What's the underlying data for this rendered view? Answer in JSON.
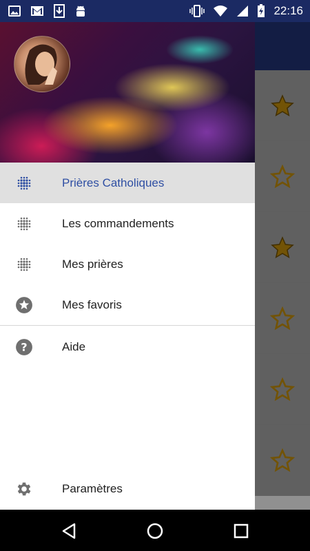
{
  "status_bar": {
    "time": "22:16",
    "icons_left": [
      "image-icon",
      "gmail-icon",
      "download-icon",
      "android-icon"
    ],
    "icons_right": [
      "vibrate-icon",
      "wifi-icon",
      "signal-icon",
      "battery-charging-icon"
    ]
  },
  "colors": {
    "status_bar": "#1b2a63",
    "app_bar": "#1f2f6e",
    "active_text": "#2f4fa3",
    "star_gold": "#b8860b"
  },
  "drawer": {
    "menu": [
      {
        "label": "Prières Catholiques",
        "icon": "dots-grid-icon",
        "active": true
      },
      {
        "label": "Les commandements",
        "icon": "dots-grid-icon",
        "active": false
      },
      {
        "label": "Mes prières",
        "icon": "dots-grid-icon",
        "active": false
      },
      {
        "label": "Mes favoris",
        "icon": "star-circle-icon",
        "active": false
      }
    ],
    "help": {
      "label": "Aide",
      "icon": "help-icon"
    },
    "settings": {
      "label": "Paramètres",
      "icon": "gear-icon"
    }
  },
  "background_list": {
    "stars": [
      true,
      false,
      true,
      false,
      false,
      false
    ]
  },
  "nav_bar": {
    "buttons": [
      "back-icon",
      "home-icon",
      "recents-icon"
    ]
  }
}
